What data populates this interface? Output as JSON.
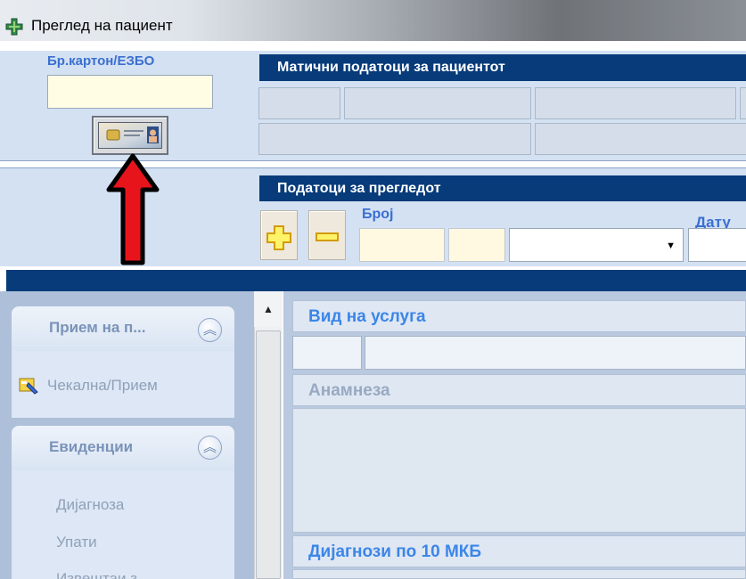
{
  "window": {
    "title": "Преглед на пациент",
    "icon": "app-cross-icon"
  },
  "card": {
    "label": "Бр.картон/ЕЗБО",
    "input_value": "",
    "read_button_icon": "id-card-icon"
  },
  "patient_section": {
    "title": "Матични податоци за пациентот"
  },
  "exam_section": {
    "title": "Податоци за прегледот",
    "add_icon": "plus-icon",
    "remove_icon": "minus-icon",
    "number_label": "Број",
    "date_label": "Дату",
    "dropdown_value": ""
  },
  "annotation": {
    "icon": "red-arrow-up-icon",
    "color": "#e8141c"
  },
  "sidebar": {
    "groups": [
      {
        "title": "Прием на п...",
        "items": [
          {
            "label": "Чекална/Прием",
            "icon": "waiting-room-icon"
          }
        ]
      },
      {
        "title": "Евиденции",
        "items": [
          {
            "label": "Дијагноза"
          },
          {
            "label": "Упати"
          },
          {
            "label": "Извештаи з..."
          }
        ]
      }
    ]
  },
  "main": {
    "service": {
      "title": "Вид на услуга",
      "color": "#3b86e8"
    },
    "anamnesis": {
      "title": "Анамнеза",
      "color": "#98a9c2"
    },
    "diagnoses": {
      "title": "Дијагнози по 10 МКБ",
      "color": "#3b86e8"
    }
  }
}
